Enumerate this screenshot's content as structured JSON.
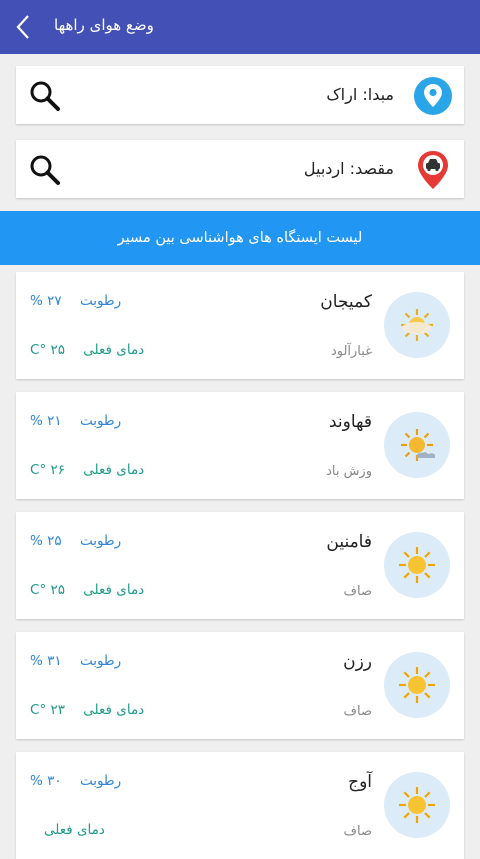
{
  "appbar": {
    "title": "وضع هوای راهها"
  },
  "origin": {
    "label": "مبدا: اراک"
  },
  "destination": {
    "label": "مقصد: اردبیل"
  },
  "banner": {
    "text": "لیست ایستگاه های هواشناسی بین مسیر"
  },
  "colors": {
    "appbar": "#4350b5",
    "banner": "#2196f3",
    "pin_origin": "#2aa5e8",
    "pin_destination": "#e53935",
    "humidity": "#2f86d6",
    "temperature": "#1f9a8a"
  },
  "stations": [
    {
      "city": "کمیجان",
      "condition": "غبارآلود",
      "icon": "dusty-sun-icon",
      "humidity_label": "رطوبت",
      "humidity": "۲۷ %",
      "temp_label": "دمای فعلی",
      "temp": "۲۵ °C"
    },
    {
      "city": "قهاوند",
      "condition": "وزش باد",
      "icon": "windy-sun-icon",
      "humidity_label": "رطوبت",
      "humidity": "۲۱ %",
      "temp_label": "دمای فعلی",
      "temp": "۲۶ °C"
    },
    {
      "city": "فامنین",
      "condition": "صاف",
      "icon": "sun-icon",
      "humidity_label": "رطوبت",
      "humidity": "۲۵ %",
      "temp_label": "دمای فعلی",
      "temp": "۲۵ °C"
    },
    {
      "city": "رزن",
      "condition": "صاف",
      "icon": "sun-icon",
      "humidity_label": "رطوبت",
      "humidity": "۳۱ %",
      "temp_label": "دمای فعلی",
      "temp": "۲۳ °C"
    },
    {
      "city": "آوج",
      "condition": "صاف",
      "icon": "sun-icon",
      "humidity_label": "رطوبت",
      "humidity": "۳۰ %",
      "temp_label": "دمای فعلی",
      "temp": ""
    }
  ]
}
